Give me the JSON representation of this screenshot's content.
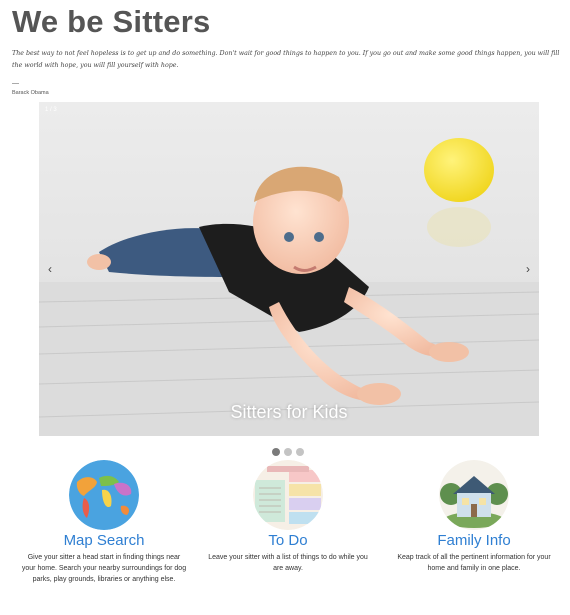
{
  "site": {
    "title": "We be Sitters"
  },
  "quote": {
    "text": "The best way to not feel hopeless is to get up and do something. Don't wait for good things to happen to you. If you go out and make some good things happen, you will fill the world with hope, you will fill yourself with hope.",
    "dash": "—",
    "author": "Barack Obama"
  },
  "slider": {
    "counter": "1 / 3",
    "caption": "Sitters for Kids",
    "prev_icon": "‹",
    "next_icon": "›",
    "slide_count": 3,
    "active_index": 0
  },
  "features": [
    {
      "title": "Map Search",
      "description": "Give your sitter a head start in finding things near your home. Search your nearby surroundings for dog parks, play grounds, libraries or anything else.",
      "icon": "world-map-icon"
    },
    {
      "title": "To Do",
      "description": "Leave your sitter with a list of things to do while you are away.",
      "icon": "todo-list-icon"
    },
    {
      "title": "Family Info",
      "description": "Keap track of all the pertinent information for your home and family in one place.",
      "icon": "house-icon"
    }
  ],
  "colors": {
    "link": "#2f7fd2",
    "title": "#555555",
    "dot_active": "#7a7a7a",
    "dot_inactive": "#c4c4c4"
  }
}
